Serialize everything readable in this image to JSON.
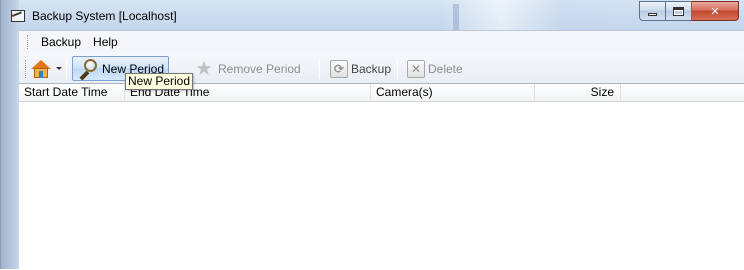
{
  "window": {
    "title": "Backup System [Localhost]"
  },
  "menu": {
    "items": [
      {
        "label": "Backup"
      },
      {
        "label": "Help"
      }
    ]
  },
  "toolbar": {
    "home_icon": "home-icon",
    "new_period_label": "New Period",
    "remove_period_label": "Remove Period",
    "backup_label": "Backup",
    "delete_label": "Delete"
  },
  "list": {
    "columns": [
      {
        "label": "Start Date Time"
      },
      {
        "label": "End Date Time"
      },
      {
        "label": "Camera(s)"
      },
      {
        "label": "Size"
      }
    ],
    "rows": []
  },
  "tooltip": {
    "text": "New Period"
  },
  "colors": {
    "accent": "#cde2f8",
    "close_button": "#c2482f",
    "tooltip_bg": "#ffffe1"
  }
}
